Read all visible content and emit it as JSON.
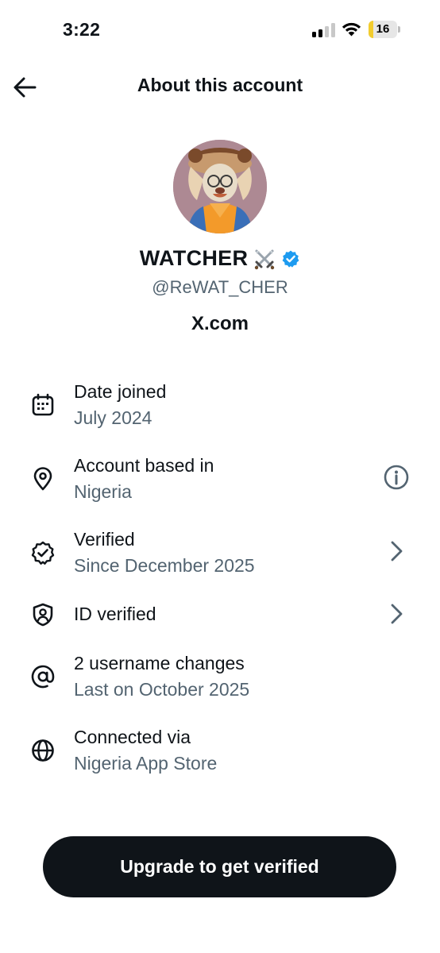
{
  "status_bar": {
    "time": "3:22",
    "battery_level": "16",
    "battery_fraction": 0.16,
    "battery_color": "#f2cc2e"
  },
  "header": {
    "title": "About this account",
    "back_icon": "arrow-left-icon"
  },
  "profile": {
    "display_name": "WATCHER",
    "name_emoji_icon": "crossed-swords-icon",
    "verified_badge_icon": "verified-badge-icon",
    "verified_color": "#1d9bf0",
    "handle": "@ReWAT_CHER",
    "domain": "X.com"
  },
  "info_rows": [
    {
      "icon": "calendar-icon",
      "label": "Date joined",
      "value": "July 2024",
      "action_icon": ""
    },
    {
      "icon": "location-pin-icon",
      "label": "Account based in",
      "value": "Nigeria",
      "action_icon": "info-icon"
    },
    {
      "icon": "verified-seal-icon",
      "label": "Verified",
      "value": "Since December 2025",
      "action_icon": "chevron-right-icon"
    },
    {
      "icon": "id-shield-icon",
      "label": "ID verified",
      "value": "",
      "action_icon": "chevron-right-icon"
    },
    {
      "icon": "at-sign-icon",
      "label": "2 username changes",
      "value": "Last on October 2025",
      "action_icon": ""
    },
    {
      "icon": "globe-icon",
      "label": "Connected via",
      "value": "Nigeria App Store",
      "action_icon": ""
    }
  ],
  "upgrade_button": {
    "label": "Upgrade to get verified"
  },
  "colors": {
    "primary_text": "#0f1419",
    "secondary_text": "#536471",
    "button_background": "#0f1419"
  }
}
